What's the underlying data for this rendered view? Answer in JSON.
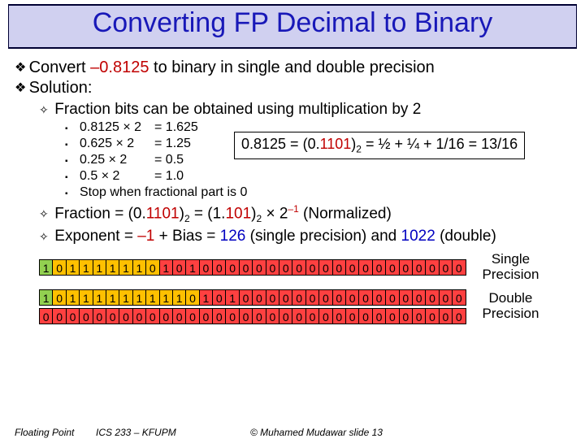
{
  "title": "Converting FP Decimal to Binary",
  "main": {
    "line1_a": "Convert ",
    "line1_b": "–0.8125",
    "line1_c": " to binary in single and double precision",
    "line2": "Solution:",
    "sub1": "Fraction bits can be obtained using multiplication by 2",
    "mults": [
      {
        "a": "0.8125 × 2",
        "b": "= 1.625"
      },
      {
        "a": "0.625 × 2",
        "b": "= 1.25"
      },
      {
        "a": "0.25 × 2",
        "b": "= 0.5"
      },
      {
        "a": "0.5 × 2",
        "b": "= 1.0"
      }
    ],
    "stop": "Stop when fractional part is 0",
    "boxed_a": "0.8125 = (0.",
    "boxed_b": "1101",
    "boxed_c": ")",
    "boxed_sub": "2",
    "boxed_d": " = ½ + ¼ + 1/16 = 13/16",
    "frac_a": "Fraction = (0.",
    "frac_b": "1101",
    "frac_c": ")",
    "frac_sub1": "2",
    "frac_d": " = (1.",
    "frac_e": "101",
    "frac_f": ")",
    "frac_sub2": "2",
    "frac_g": " × 2",
    "frac_sup": "–1",
    "frac_h": " (Normalized)",
    "exp_a": "Exponent = ",
    "exp_b": "–1",
    "exp_c": " + Bias = ",
    "exp_d": "126",
    "exp_e": " (single precision) and ",
    "exp_f": "1022",
    "exp_g": " (double)"
  },
  "single_bits": [
    "1",
    "0",
    "1",
    "1",
    "1",
    "1",
    "1",
    "1",
    "0",
    "1",
    "0",
    "1",
    "0",
    "0",
    "0",
    "0",
    "0",
    "0",
    "0",
    "0",
    "0",
    "0",
    "0",
    "0",
    "0",
    "0",
    "0",
    "0",
    "0",
    "0",
    "0",
    "0"
  ],
  "double_bits_hi": [
    "1",
    "0",
    "1",
    "1",
    "1",
    "1",
    "1",
    "1",
    "1",
    "1",
    "1",
    "0",
    "1",
    "0",
    "1",
    "0",
    "0",
    "0",
    "0",
    "0",
    "0",
    "0",
    "0",
    "0",
    "0",
    "0",
    "0",
    "0",
    "0",
    "0",
    "0",
    "0"
  ],
  "double_bits_lo": [
    "0",
    "0",
    "0",
    "0",
    "0",
    "0",
    "0",
    "0",
    "0",
    "0",
    "0",
    "0",
    "0",
    "0",
    "0",
    "0",
    "0",
    "0",
    "0",
    "0",
    "0",
    "0",
    "0",
    "0",
    "0",
    "0",
    "0",
    "0",
    "0",
    "0",
    "0",
    "0"
  ],
  "labels": {
    "single": "Single Precision",
    "double": "Double Precision"
  },
  "footer": {
    "left": "Floating Point",
    "mid": "ICS 233 – KFUPM",
    "right": "© Muhamed Mudawar  slide 13"
  }
}
